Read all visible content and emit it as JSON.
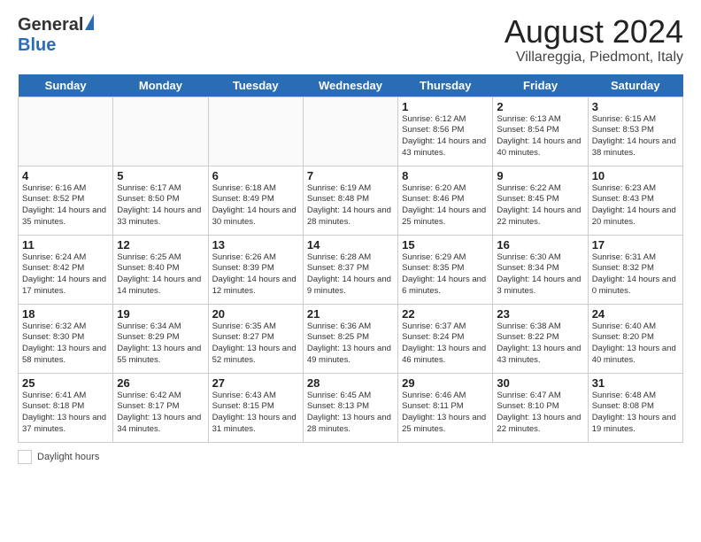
{
  "header": {
    "logo_general": "General",
    "logo_blue": "Blue",
    "main_title": "August 2024",
    "subtitle": "Villareggia, Piedmont, Italy"
  },
  "days_of_week": [
    "Sunday",
    "Monday",
    "Tuesday",
    "Wednesday",
    "Thursday",
    "Friday",
    "Saturday"
  ],
  "weeks": [
    [
      {
        "date": "",
        "info": ""
      },
      {
        "date": "",
        "info": ""
      },
      {
        "date": "",
        "info": ""
      },
      {
        "date": "",
        "info": ""
      },
      {
        "date": "1",
        "info": "Sunrise: 6:12 AM\nSunset: 8:56 PM\nDaylight: 14 hours and 43 minutes."
      },
      {
        "date": "2",
        "info": "Sunrise: 6:13 AM\nSunset: 8:54 PM\nDaylight: 14 hours and 40 minutes."
      },
      {
        "date": "3",
        "info": "Sunrise: 6:15 AM\nSunset: 8:53 PM\nDaylight: 14 hours and 38 minutes."
      }
    ],
    [
      {
        "date": "4",
        "info": "Sunrise: 6:16 AM\nSunset: 8:52 PM\nDaylight: 14 hours and 35 minutes."
      },
      {
        "date": "5",
        "info": "Sunrise: 6:17 AM\nSunset: 8:50 PM\nDaylight: 14 hours and 33 minutes."
      },
      {
        "date": "6",
        "info": "Sunrise: 6:18 AM\nSunset: 8:49 PM\nDaylight: 14 hours and 30 minutes."
      },
      {
        "date": "7",
        "info": "Sunrise: 6:19 AM\nSunset: 8:48 PM\nDaylight: 14 hours and 28 minutes."
      },
      {
        "date": "8",
        "info": "Sunrise: 6:20 AM\nSunset: 8:46 PM\nDaylight: 14 hours and 25 minutes."
      },
      {
        "date": "9",
        "info": "Sunrise: 6:22 AM\nSunset: 8:45 PM\nDaylight: 14 hours and 22 minutes."
      },
      {
        "date": "10",
        "info": "Sunrise: 6:23 AM\nSunset: 8:43 PM\nDaylight: 14 hours and 20 minutes."
      }
    ],
    [
      {
        "date": "11",
        "info": "Sunrise: 6:24 AM\nSunset: 8:42 PM\nDaylight: 14 hours and 17 minutes."
      },
      {
        "date": "12",
        "info": "Sunrise: 6:25 AM\nSunset: 8:40 PM\nDaylight: 14 hours and 14 minutes."
      },
      {
        "date": "13",
        "info": "Sunrise: 6:26 AM\nSunset: 8:39 PM\nDaylight: 14 hours and 12 minutes."
      },
      {
        "date": "14",
        "info": "Sunrise: 6:28 AM\nSunset: 8:37 PM\nDaylight: 14 hours and 9 minutes."
      },
      {
        "date": "15",
        "info": "Sunrise: 6:29 AM\nSunset: 8:35 PM\nDaylight: 14 hours and 6 minutes."
      },
      {
        "date": "16",
        "info": "Sunrise: 6:30 AM\nSunset: 8:34 PM\nDaylight: 14 hours and 3 minutes."
      },
      {
        "date": "17",
        "info": "Sunrise: 6:31 AM\nSunset: 8:32 PM\nDaylight: 14 hours and 0 minutes."
      }
    ],
    [
      {
        "date": "18",
        "info": "Sunrise: 6:32 AM\nSunset: 8:30 PM\nDaylight: 13 hours and 58 minutes."
      },
      {
        "date": "19",
        "info": "Sunrise: 6:34 AM\nSunset: 8:29 PM\nDaylight: 13 hours and 55 minutes."
      },
      {
        "date": "20",
        "info": "Sunrise: 6:35 AM\nSunset: 8:27 PM\nDaylight: 13 hours and 52 minutes."
      },
      {
        "date": "21",
        "info": "Sunrise: 6:36 AM\nSunset: 8:25 PM\nDaylight: 13 hours and 49 minutes."
      },
      {
        "date": "22",
        "info": "Sunrise: 6:37 AM\nSunset: 8:24 PM\nDaylight: 13 hours and 46 minutes."
      },
      {
        "date": "23",
        "info": "Sunrise: 6:38 AM\nSunset: 8:22 PM\nDaylight: 13 hours and 43 minutes."
      },
      {
        "date": "24",
        "info": "Sunrise: 6:40 AM\nSunset: 8:20 PM\nDaylight: 13 hours and 40 minutes."
      }
    ],
    [
      {
        "date": "25",
        "info": "Sunrise: 6:41 AM\nSunset: 8:18 PM\nDaylight: 13 hours and 37 minutes."
      },
      {
        "date": "26",
        "info": "Sunrise: 6:42 AM\nSunset: 8:17 PM\nDaylight: 13 hours and 34 minutes."
      },
      {
        "date": "27",
        "info": "Sunrise: 6:43 AM\nSunset: 8:15 PM\nDaylight: 13 hours and 31 minutes."
      },
      {
        "date": "28",
        "info": "Sunrise: 6:45 AM\nSunset: 8:13 PM\nDaylight: 13 hours and 28 minutes."
      },
      {
        "date": "29",
        "info": "Sunrise: 6:46 AM\nSunset: 8:11 PM\nDaylight: 13 hours and 25 minutes."
      },
      {
        "date": "30",
        "info": "Sunrise: 6:47 AM\nSunset: 8:10 PM\nDaylight: 13 hours and 22 minutes."
      },
      {
        "date": "31",
        "info": "Sunrise: 6:48 AM\nSunset: 8:08 PM\nDaylight: 13 hours and 19 minutes."
      }
    ]
  ],
  "footer": {
    "label": "Daylight hours"
  }
}
